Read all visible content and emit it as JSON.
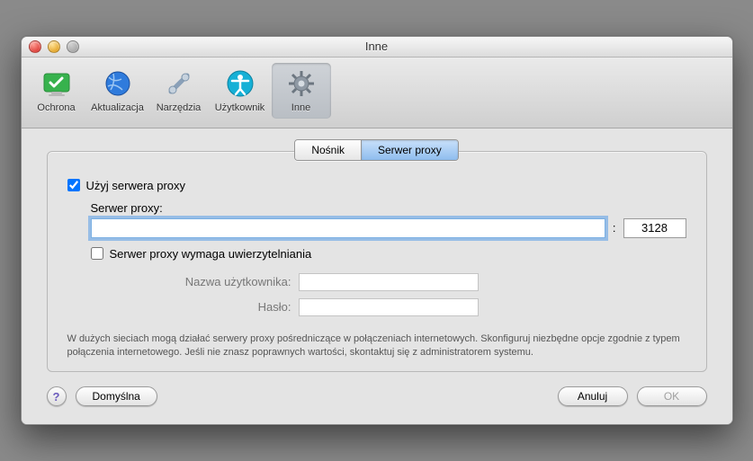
{
  "window": {
    "title": "Inne"
  },
  "traffic": {
    "close": "close",
    "min": "minimize",
    "zoom": "zoom"
  },
  "toolbar": {
    "items": [
      {
        "id": "ochrona",
        "label": "Ochrona"
      },
      {
        "id": "aktualizacja",
        "label": "Aktualizacja"
      },
      {
        "id": "narzedzia",
        "label": "Narzędzia"
      },
      {
        "id": "uzytkownik",
        "label": "Użytkownik"
      },
      {
        "id": "inne",
        "label": "Inne"
      }
    ]
  },
  "tabs": {
    "nosnik": "Nośnik",
    "serwer_proxy": "Serwer proxy"
  },
  "proxy": {
    "use_label": "Użyj serwera proxy",
    "use_checked": true,
    "server_label": "Serwer proxy:",
    "server_value": "",
    "port_value": "3128",
    "colon": ":",
    "auth_label": "Serwer proxy wymaga uwierzytelniania",
    "auth_checked": false,
    "username_label": "Nazwa użytkownika:",
    "username_value": "",
    "password_label": "Hasło:",
    "password_value": ""
  },
  "description": "W dużych sieciach mogą działać serwery proxy pośredniczące w połączeniach internetowych. Skonfiguruj niezbędne opcje zgodnie z typem połączenia internetowego. Jeśli nie znasz poprawnych wartości, skontaktuj się z administratorem systemu.",
  "footer": {
    "help": "?",
    "defaults": "Domyślna",
    "cancel": "Anuluj",
    "ok": "OK"
  }
}
